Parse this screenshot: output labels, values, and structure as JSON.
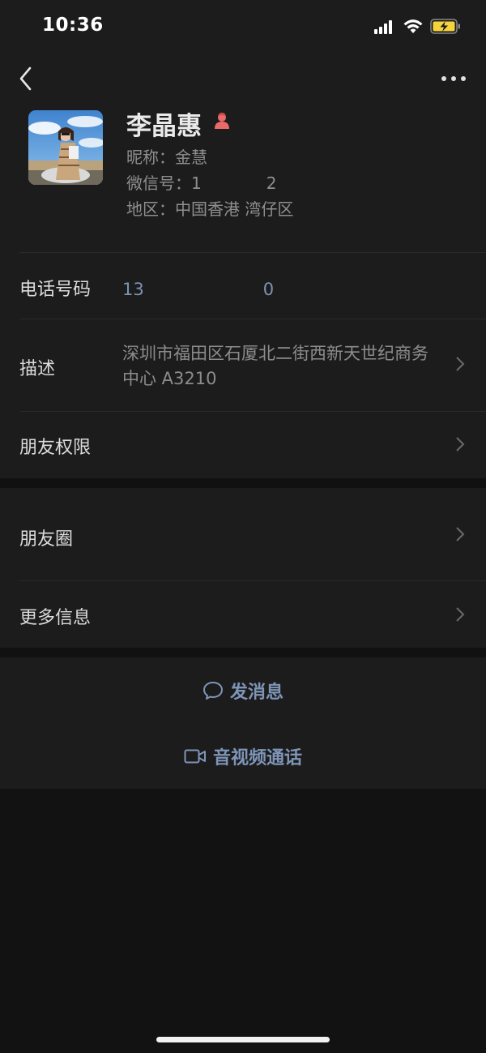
{
  "status_bar": {
    "time": "10:36"
  },
  "header": {
    "back_icon": "chevron-left-icon",
    "more_icon": "more-dots-icon"
  },
  "profile": {
    "name": "李晶惠",
    "gender_icon": "female-icon",
    "nickname": "昵称：金慧",
    "wechat_id": "微信号：1　　　　2",
    "region": "地区：中国香港 湾仔区"
  },
  "rows": {
    "phone": {
      "label": "电话号码",
      "value": "13　　　　　　　0"
    },
    "description": {
      "label": "描述",
      "value": "深圳市福田区石厦北二街西新天世纪商务中心 A3210"
    },
    "friend_permissions": {
      "label": "朋友权限"
    },
    "moments": {
      "label": "朋友圈"
    },
    "more_info": {
      "label": "更多信息"
    }
  },
  "actions": {
    "message": {
      "label": "发消息",
      "icon": "chat-bubble-icon"
    },
    "call": {
      "label": "音视频通话",
      "icon": "video-camera-icon"
    }
  },
  "colors": {
    "background": "#1c1c1c",
    "link_blue": "#7e95b8",
    "text_primary": "#dcdcdc",
    "text_secondary": "#8f8f8f"
  }
}
